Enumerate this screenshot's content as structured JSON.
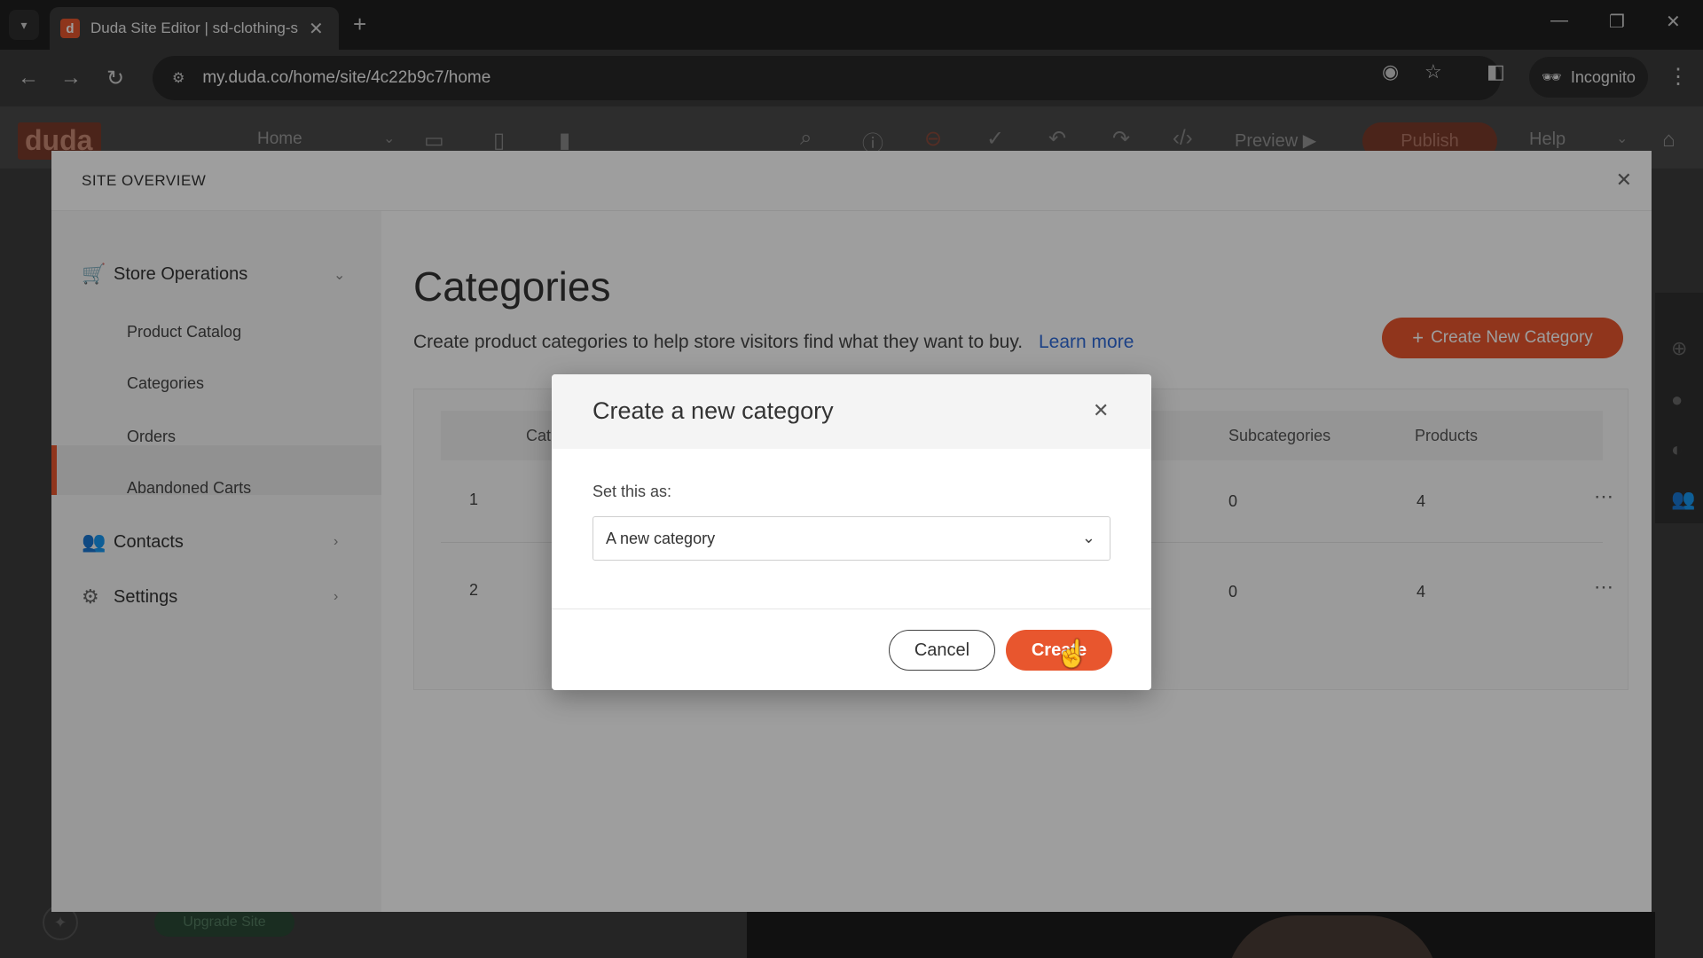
{
  "browser": {
    "tab_title": "Duda Site Editor | sd-clothing-s",
    "tab_favicon_letter": "d",
    "url": "my.duda.co/home/site/4c22b9c7/home",
    "incognito_label": "Incognito"
  },
  "editor": {
    "logo": "duda",
    "page_select": "Home",
    "preview_label": "Preview",
    "publish_label": "Publish",
    "help_label": "Help",
    "upgrade_label": "Upgrade Site"
  },
  "panel": {
    "title": "SITE OVERVIEW",
    "sidebar": {
      "store_operations": "Store Operations",
      "product_catalog": "Product Catalog",
      "categories": "Categories",
      "orders": "Orders",
      "abandoned_carts": "Abandoned Carts",
      "contacts": "Contacts",
      "settings": "Settings"
    },
    "heading": "Categories",
    "subheading": "Create product categories to help store visitors find what they want to buy.",
    "learn_more": "Learn more",
    "create_new_label": "Create New Category",
    "table": {
      "col_category_partial": "Cat",
      "col_subcategories": "Subcategories",
      "col_products": "Products",
      "rows": [
        {
          "index": "1",
          "subcategories": "0",
          "products": "4"
        },
        {
          "index": "2",
          "subcategories": "0",
          "products": "4"
        }
      ]
    }
  },
  "modal": {
    "title": "Create a new category",
    "field_label": "Set this as:",
    "select_value": "A new category",
    "cancel_label": "Cancel",
    "create_label": "Create"
  }
}
